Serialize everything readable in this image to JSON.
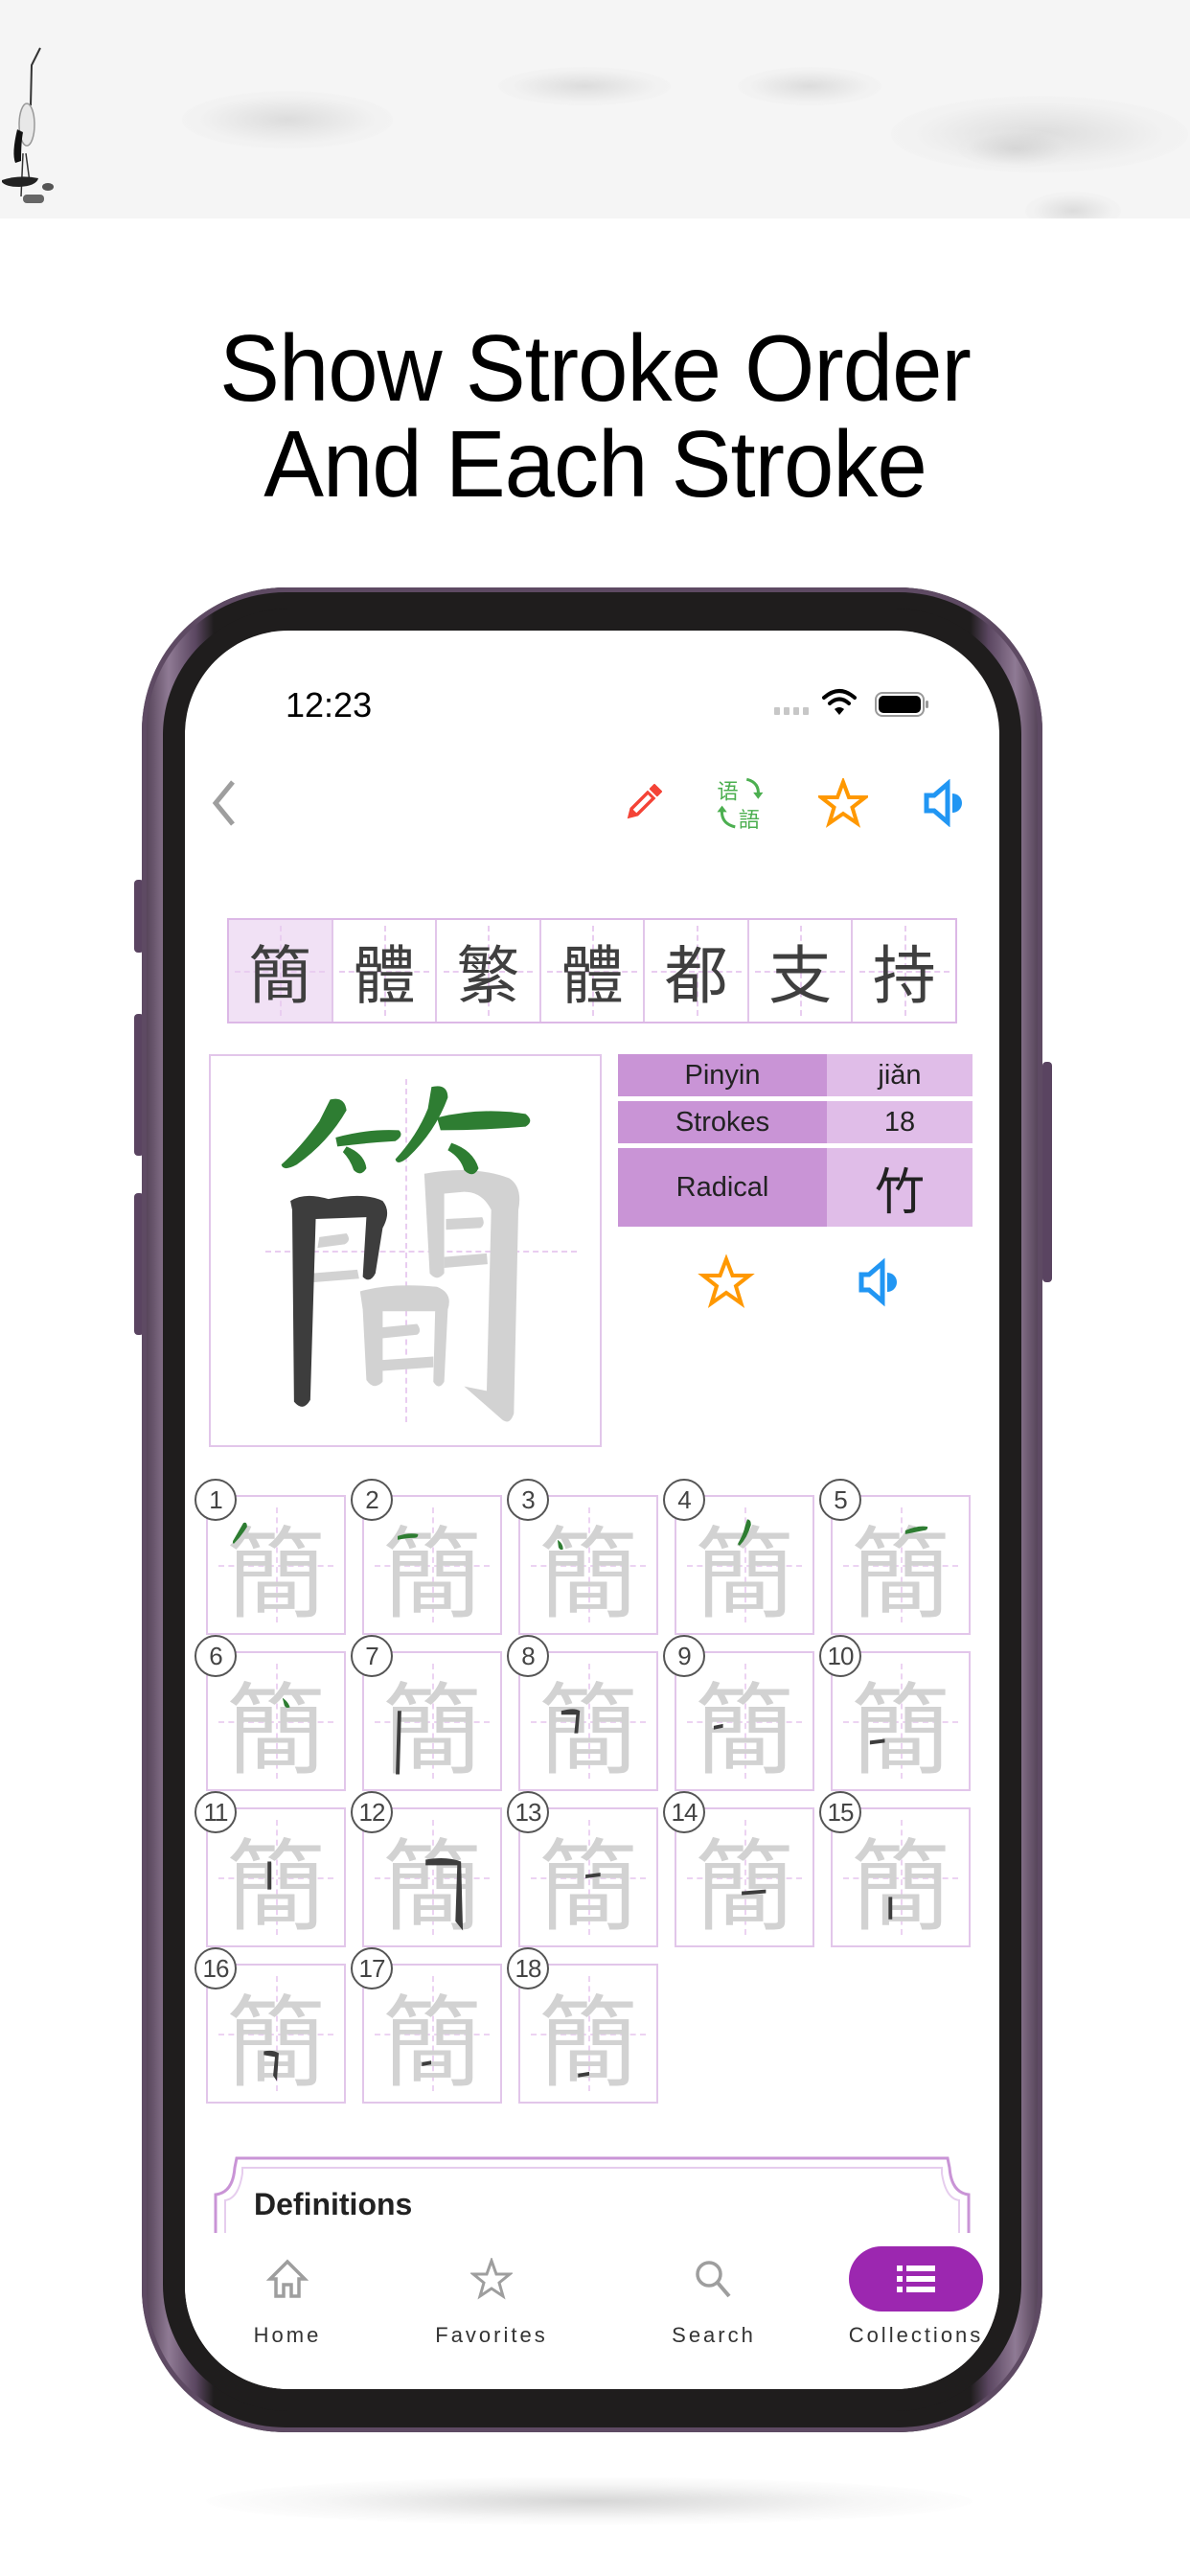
{
  "headline": {
    "line1": "Show Stroke Order",
    "line2": "And Each Stroke"
  },
  "status_bar": {
    "time": "12:23",
    "icons": [
      "cellular-signal-icon",
      "wifi-icon",
      "battery-icon"
    ]
  },
  "toolbar": {
    "back_icon": "chevron-left-icon",
    "actions": [
      {
        "name": "edit",
        "icon": "pencil-icon",
        "color": "#f44336"
      },
      {
        "name": "convert-script",
        "icon": "simplified-traditional-convert-icon",
        "glyph_top": "语",
        "glyph_bottom": "語",
        "color": "#4caf50"
      },
      {
        "name": "favorite",
        "icon": "star-outline-icon",
        "color": "#ff9800"
      },
      {
        "name": "pronounce",
        "icon": "speaker-icon",
        "color": "#2196f3"
      }
    ]
  },
  "character_strip": {
    "characters": [
      "簡",
      "體",
      "繁",
      "體",
      "都",
      "支",
      "持"
    ],
    "selected_index": 0
  },
  "character": {
    "glyph": "簡",
    "highlighted_strokes": 6,
    "pinyin_label": "Pinyin",
    "pinyin": "jiǎn",
    "strokes_label": "Strokes",
    "strokes": "18",
    "radical_label": "Radical",
    "radical": "竹",
    "favorite_icon": "star-outline-icon",
    "audio_icon": "speaker-icon"
  },
  "stroke_order": {
    "glyph": "簡",
    "steps": [
      "1",
      "2",
      "3",
      "4",
      "5",
      "6",
      "7",
      "8",
      "9",
      "10",
      "11",
      "12",
      "13",
      "14",
      "15",
      "16",
      "17",
      "18"
    ]
  },
  "definitions": {
    "title": "Definitions"
  },
  "tab_bar": {
    "tabs": [
      {
        "label": "Home",
        "icon": "home-icon",
        "active": false
      },
      {
        "label": "Favorites",
        "icon": "star-outline-icon",
        "active": false
      },
      {
        "label": "Search",
        "icon": "search-icon",
        "active": false
      },
      {
        "label": "Collections",
        "icon": "list-icon",
        "active": true
      }
    ]
  },
  "colors": {
    "accent": "#9c27b0",
    "grid_border": "#e2c6ea",
    "table_label_bg": "#c994d6",
    "table_value_bg": "#e0bde8",
    "stroke_green": "#2e7d32",
    "stroke_dark": "#3d3d3d",
    "ghost_gray": "#d2d2d2"
  }
}
